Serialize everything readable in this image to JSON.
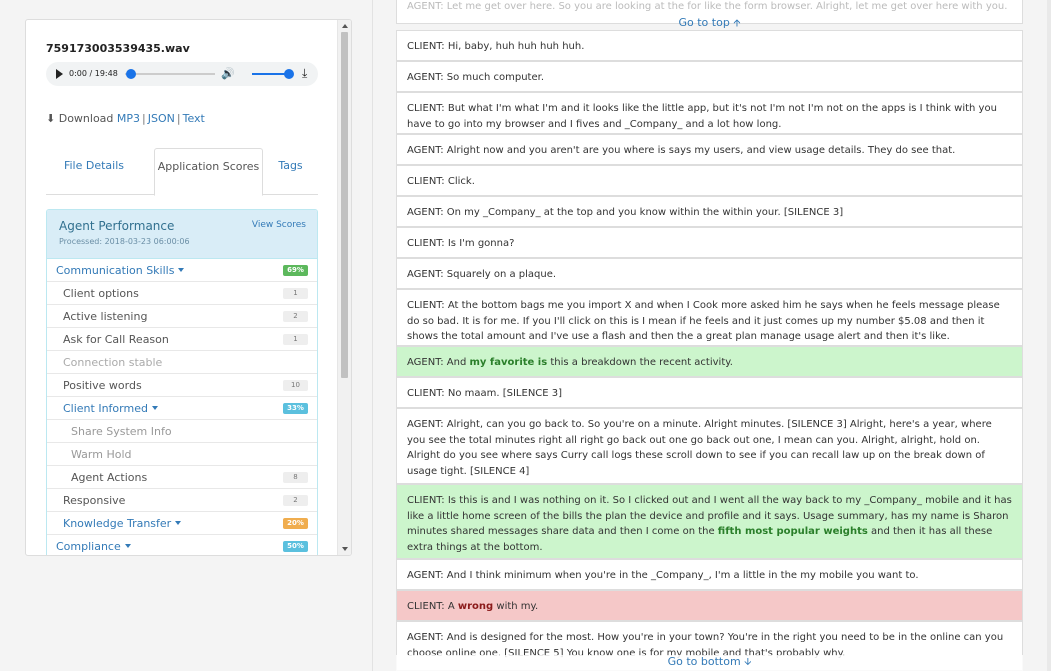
{
  "left": {
    "file_name": "759173003539435.wav",
    "player": {
      "time": "0:00 / 19:48",
      "play_icon": "play-icon",
      "volume_icon": "volume-icon",
      "download_icon": "download-icon"
    },
    "downloads": {
      "prefix": "Download",
      "mp3": "MP3",
      "json": "JSON",
      "text": "Text"
    },
    "tabs": [
      {
        "label": "File Details"
      },
      {
        "label": "Application Scores"
      },
      {
        "label": "Tags"
      }
    ],
    "scores": {
      "title": "Agent Performance",
      "processed": "Processed: 2018-03-23 06:00:06",
      "view": "View Scores",
      "communication": {
        "label": "Communication Skills",
        "badge": "69%"
      },
      "items": [
        {
          "label": "Client options",
          "badge": "1"
        },
        {
          "label": "Active listening",
          "badge": "2"
        },
        {
          "label": "Ask for Call Reason",
          "badge": "1"
        },
        {
          "label": "Connection stable",
          "badge": ""
        },
        {
          "label": "Positive words",
          "badge": "10"
        }
      ],
      "client_informed": {
        "label": "Client Informed",
        "badge": "33%"
      },
      "sub_items": [
        {
          "label": "Share System Info",
          "badge": ""
        },
        {
          "label": "Warm Hold",
          "badge": ""
        },
        {
          "label": "Agent Actions",
          "badge": "8"
        }
      ],
      "responsive": {
        "label": "Responsive",
        "badge": "2"
      },
      "knowledge": {
        "label": "Knowledge Transfer",
        "badge": "20%"
      },
      "compliance": {
        "label": "Compliance",
        "badge": "50%"
      }
    },
    "colors": {
      "green_badge": "#5cb85c",
      "blue_badge": "#5bc0de",
      "orange_badge": "#f0ad4e"
    }
  },
  "transcript": {
    "go_top": "Go to top",
    "go_bottom": "Go to bottom",
    "faded_top": "AGENT: Let me get over here. So you are looking at the for like the form browser. Alright, let me get over here with you.",
    "lines": [
      {
        "text": "CLIENT: Hi, baby, huh huh huh huh."
      },
      {
        "text": "AGENT: So much computer."
      },
      {
        "text": "CLIENT: But what I'm what I'm and it looks like the little app, but it's not I'm not I'm not on the apps is I think with you have to go into my browser and I fives and _Company_ and a lot how long."
      },
      {
        "text": "AGENT: Alright now and you aren't are you where is says my users, and view usage details. They do see that."
      },
      {
        "text": "CLIENT: Click."
      },
      {
        "text": "AGENT: On my _Company_ at the top and you know within the within your. [SILENCE 3]"
      },
      {
        "text": "CLIENT: Is I'm gonna?"
      },
      {
        "text": "AGENT: Squarely on a plaque."
      },
      {
        "text": "CLIENT: At the bottom bags me you import X and when I Cook more asked him he says when he feels message please do so bad. It is for me. If you I'll click on this is I mean if he feels and it just comes up my number $5.08 and then it shows the total amount and I've use a flash and then the a great plan manage usage alert and then it's like."
      },
      {
        "pre": "AGENT: And ",
        "hl": "my favorite is",
        "post": " this a breakdown the recent activity."
      },
      {
        "text": "CLIENT: No maam. [SILENCE 3]"
      },
      {
        "text": "AGENT: Alright, can you go back to. So you're on a minute. Alright minutes. [SILENCE 3] Alright, here's a year, where you see the total minutes right all right go back out one go back out one, I mean can you. Alright, alright, hold on. Alright do you see where says Curry call logs these scroll down to see if you can recall law up on the break down of usage tight. [SILENCE 4]"
      },
      {
        "pre": "CLIENT: Is this is and I was nothing on it. So I clicked out and I went all the way back to my _Company_ mobile and it has like a little home screen of the bills the plan the device and profile and it says. Usage summary, has my name is Sharon minutes shared messages share data and then I come on the ",
        "hl": "fifth most popular weights",
        "post": " and then it has all these extra things at the bottom."
      },
      {
        "text": "AGENT: And I think minimum when you're in the _Company_, I'm a little in the my mobile you want to."
      },
      {
        "pre": "CLIENT: A ",
        "hl": "wrong",
        "post": " with my."
      },
      {
        "text": "AGENT: And is designed for the most. How you're in your town? You're in the right you need to be in the online can you choose online one. [SILENCE 5] You know one is for my mobile and that's probably why."
      }
    ]
  }
}
